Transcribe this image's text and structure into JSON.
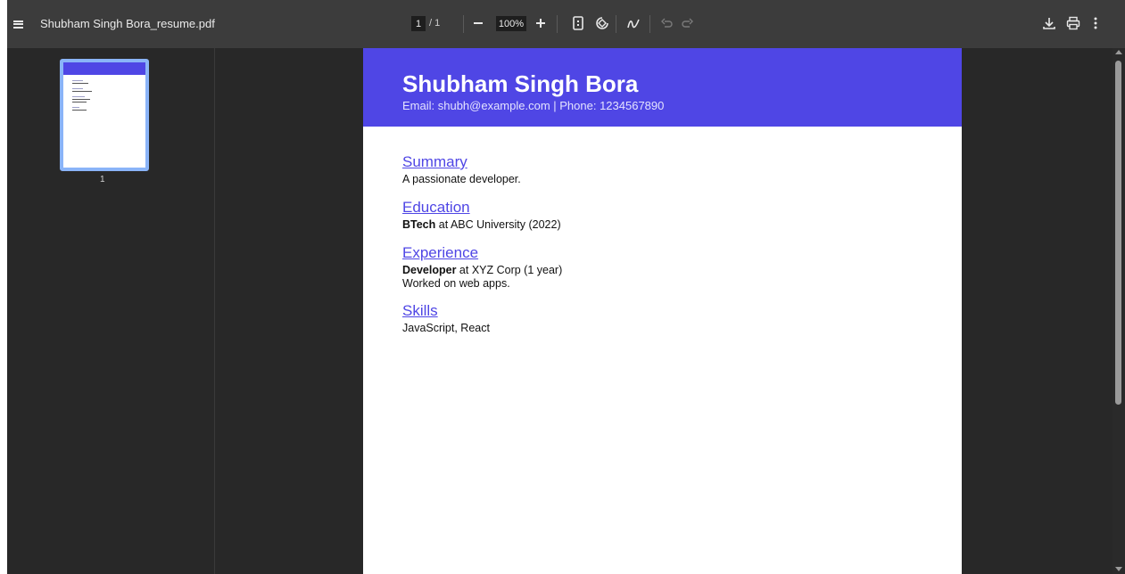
{
  "toolbar": {
    "doc_title": "Shubham Singh Bora_resume.pdf",
    "page_current": "1",
    "page_total": "/ 1",
    "zoom": "100%",
    "icons": [
      "menu-icon",
      "minus-icon",
      "plus-icon",
      "fit-page-icon",
      "rotate-icon",
      "annotate-icon",
      "undo-icon",
      "redo-icon",
      "download-icon",
      "print-icon",
      "more-icon"
    ]
  },
  "sidebar": {
    "thumbnail_label": "1"
  },
  "resume": {
    "name": "Shubham Singh Bora",
    "contact": "Email: shubh@example.com | Phone: 1234567890",
    "summary_title": "Summary",
    "summary_text": "A passionate developer.",
    "education_title": "Education",
    "education_degree": "BTech",
    "education_rest": " at ABC University (2022)",
    "experience_title": "Experience",
    "experience_role": "Developer",
    "experience_rest": " at XYZ Corp (1 year)",
    "experience_detail": "Worked on web apps.",
    "skills_title": "Skills",
    "skills_text": "JavaScript, React"
  },
  "colors": {
    "accent": "#4f46e5",
    "toolbar_bg": "#3c3c3c",
    "viewer_bg": "#282828",
    "thumb_border": "#8ab4f8"
  }
}
